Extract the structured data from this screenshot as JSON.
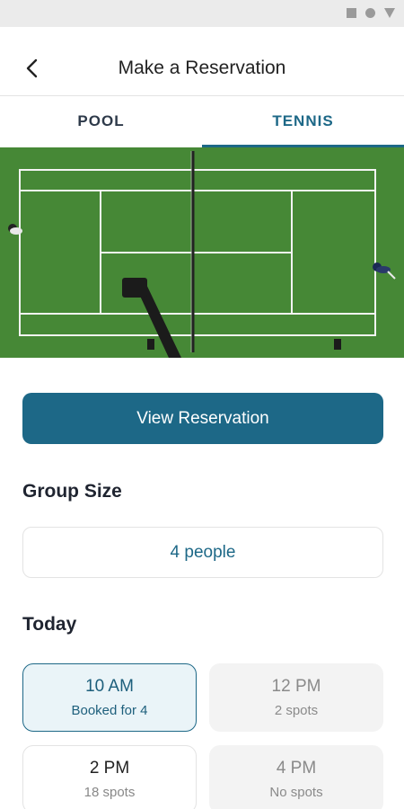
{
  "header": {
    "title": "Make a Reservation",
    "back_icon": "chevron-left-icon"
  },
  "tabs": [
    {
      "label": "POOL",
      "active": false
    },
    {
      "label": "TENNIS",
      "active": true
    }
  ],
  "hero": {
    "image": "tennis-court-aerial-photo"
  },
  "primary_button": {
    "label": "View Reservation"
  },
  "group_size": {
    "title": "Group Size",
    "value": "4 people"
  },
  "today": {
    "title": "Today",
    "slots": [
      {
        "time": "10 AM",
        "status": "Booked for 4",
        "state": "selected"
      },
      {
        "time": "12 PM",
        "status": "2 spots",
        "state": "disabled"
      },
      {
        "time": "2 PM",
        "status": "18 spots",
        "state": "available"
      },
      {
        "time": "4 PM",
        "status": "No spots",
        "state": "disabled"
      }
    ]
  },
  "colors": {
    "accent": "#1d6887",
    "court": "#4a8f3a",
    "lines": "#ffffff"
  }
}
